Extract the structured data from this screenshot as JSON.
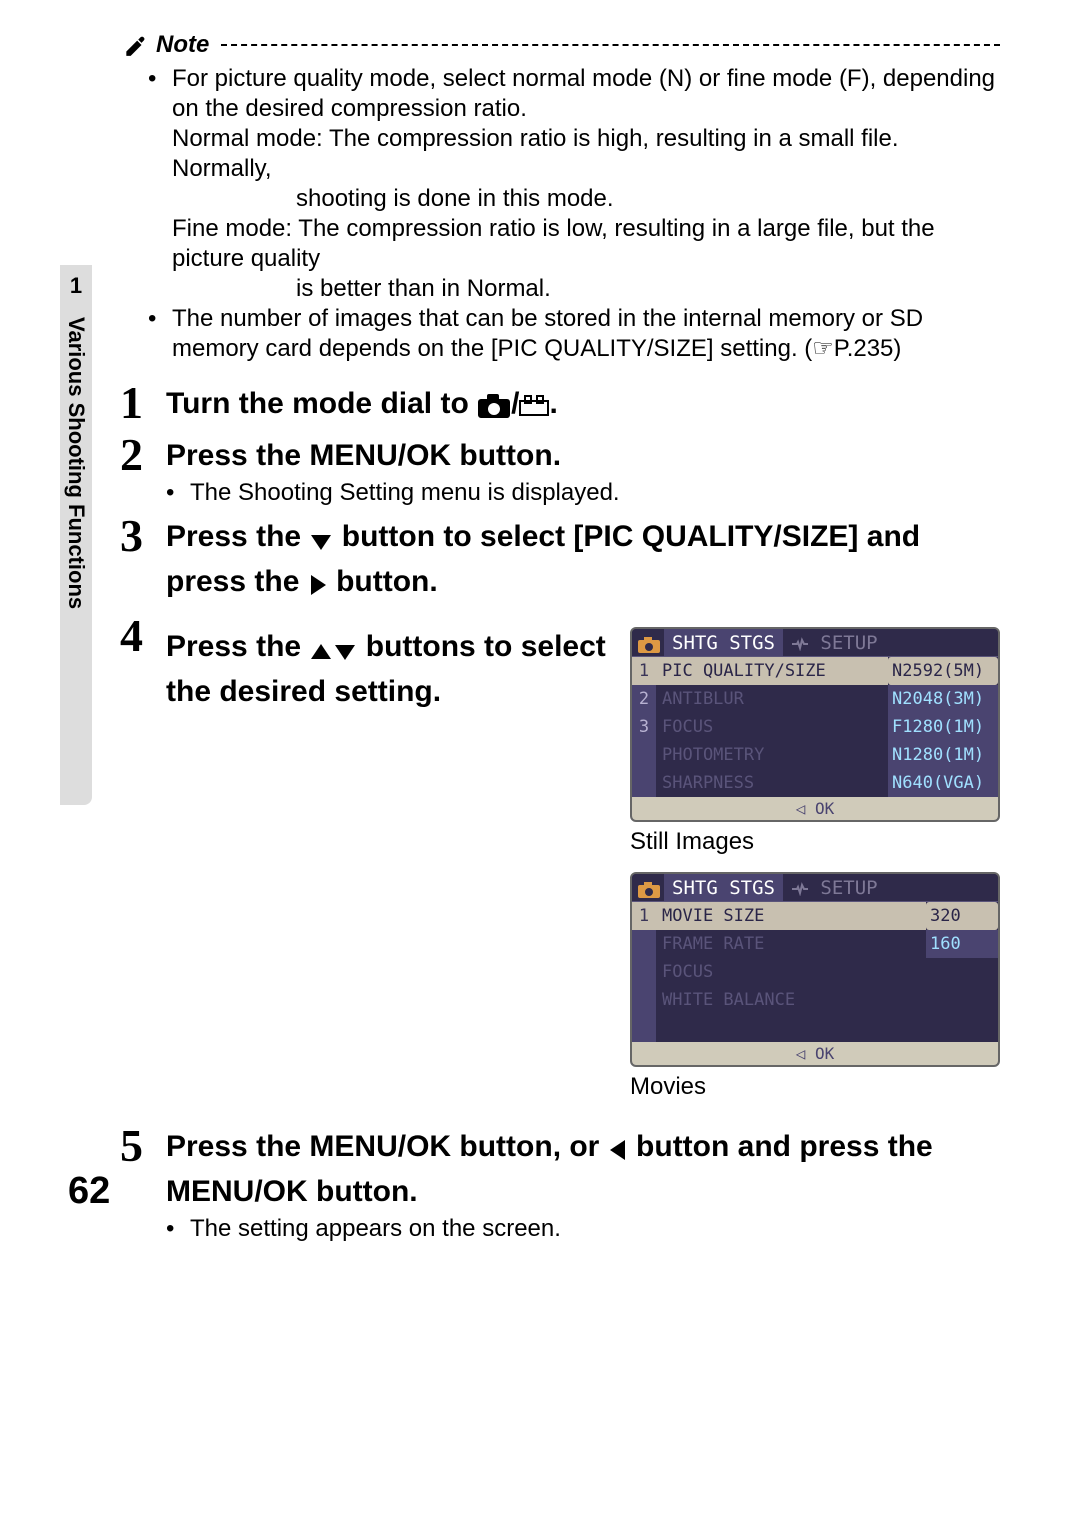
{
  "sidebar": {
    "section_number": "1",
    "section_title": "Various Shooting Functions"
  },
  "note": {
    "heading": "Note",
    "bullets": [
      "For picture quality mode, select normal mode (N) or fine mode (F), depending on the desired compression ratio.",
      "The number of images that can be stored in the internal memory or SD memory card depends on the [PIC QUALITY/SIZE] setting. (☞P.235)"
    ],
    "normal_label": "Normal mode:",
    "normal_text_a": "The compression ratio is high, resulting in a small file. Normally,",
    "normal_text_b": "shooting is done in this mode.",
    "fine_label": "Fine mode:",
    "fine_text_a": "The compression ratio is low, resulting in a large file, but the picture quality",
    "fine_text_b": "is better than in Normal."
  },
  "steps": {
    "s1": {
      "num": "1",
      "title_a": "Turn the mode dial to ",
      "title_b": "/",
      "title_c": "."
    },
    "s2": {
      "num": "2",
      "title": "Press the MENU/OK button.",
      "sub": "The Shooting Setting menu is displayed."
    },
    "s3": {
      "num": "3",
      "title_a": "Press the ",
      "title_b": " button to select [PIC QUALITY/SIZE] and press the ",
      "title_c": " button."
    },
    "s4": {
      "num": "4",
      "title_a": "Press the ",
      "title_b": " buttons to select the desired setting."
    },
    "s5": {
      "num": "5",
      "title_a": "Press the MENU/OK button, or ",
      "title_b": " button and press the MENU/OK button.",
      "sub": "The setting appears on the screen."
    }
  },
  "screen1": {
    "tab_active": "SHTG STGS",
    "tab_inactive": "SETUP",
    "rows": [
      {
        "n": "1",
        "label": "PIC QUALITY/SIZE",
        "val": "N2592(5M)",
        "sel": true
      },
      {
        "n": "2",
        "label": "ANTIBLUR",
        "val": "N2048(3M)"
      },
      {
        "n": "3",
        "label": "FOCUS",
        "val": "F1280(1M)"
      },
      {
        "n": "",
        "label": "PHOTOMETRY",
        "val": "N1280(1M)"
      },
      {
        "n": "",
        "label": "SHARPNESS",
        "val": "N640(VGA)"
      }
    ],
    "footer": "◁ OK",
    "caption": "Still Images"
  },
  "screen2": {
    "tab_active": "SHTG STGS",
    "tab_inactive": "SETUP",
    "rows": [
      {
        "n": "1",
        "label": "MOVIE SIZE",
        "val": "320",
        "sel": true
      },
      {
        "n": "",
        "label": "FRAME RATE",
        "val": "160"
      },
      {
        "n": "",
        "label": "FOCUS",
        "val": ""
      },
      {
        "n": "",
        "label": "WHITE BALANCE",
        "val": ""
      },
      {
        "n": "",
        "label": "",
        "val": ""
      }
    ],
    "footer": "◁ OK",
    "caption": "Movies"
  },
  "page_number": "62"
}
